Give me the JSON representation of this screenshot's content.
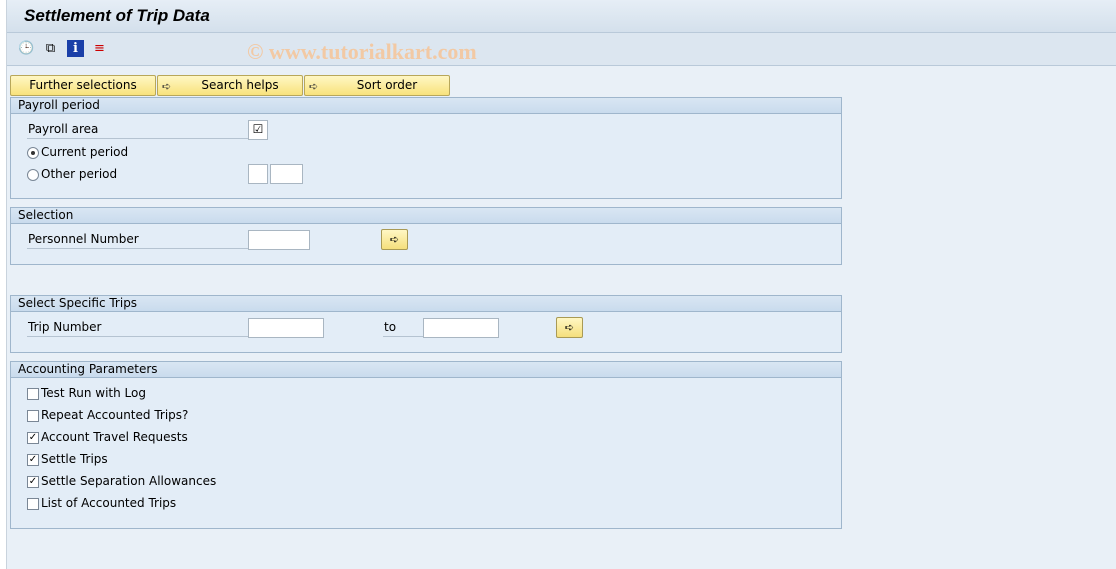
{
  "title": "Settlement of Trip Data",
  "watermark": "© www.tutorialkart.com",
  "toolbar": {
    "icons": [
      "execute-icon",
      "get-variant-icon",
      "info-icon",
      "selection-options-icon"
    ]
  },
  "buttons": {
    "further": "Further selections",
    "search": "Search helps",
    "sort": "Sort order"
  },
  "payroll": {
    "header": "Payroll period",
    "area_label": "Payroll area",
    "current": "Current period",
    "other": "Other period",
    "selected": "current"
  },
  "selection": {
    "header": "Selection",
    "pernr_label": "Personnel Number",
    "pernr_value": ""
  },
  "trips": {
    "header": "Select Specific Trips",
    "trip_label": "Trip Number",
    "to_label": "to",
    "from_value": "",
    "to_value": ""
  },
  "accounting": {
    "header": "Accounting Parameters",
    "options": [
      {
        "label": "Test Run with Log",
        "checked": false
      },
      {
        "label": "Repeat Accounted Trips?",
        "checked": false
      },
      {
        "label": "Account Travel Requests",
        "checked": true
      },
      {
        "label": "Settle Trips",
        "checked": true
      },
      {
        "label": "Settle Separation Allowances",
        "checked": true
      },
      {
        "label": "List of Accounted Trips",
        "checked": false
      }
    ]
  }
}
